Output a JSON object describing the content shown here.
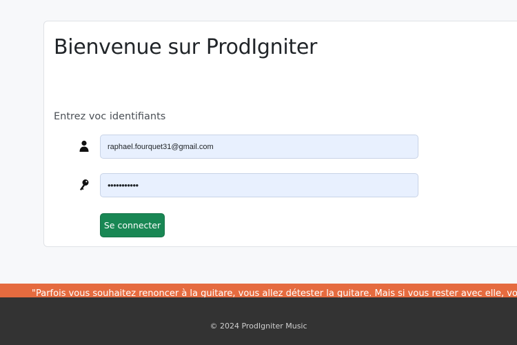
{
  "login": {
    "title": "Bienvenue sur ProdIgniter",
    "subtitle": "Entrez voc identifiants",
    "email": {
      "icon": "user-icon",
      "value": "raphael.fourquet31@gmail.com"
    },
    "password": {
      "icon": "key-icon",
      "value": "•••••••••••"
    },
    "submit_label": "Se connecter"
  },
  "quote": {
    "text": "\"Parfois vous souhaitez renoncer à la guitare, vous allez détester la guitare. Mais si vous rester avec elle, vous allez être récompensé.\""
  },
  "footer": {
    "copyright": "© 2024 ProdIgniter Music"
  },
  "colors": {
    "page_background": "#f7f8fa",
    "input_background": "#e8f0fe",
    "submit_button": "#198754",
    "quote_bar": "#e56b3f",
    "footer": "#333333"
  }
}
